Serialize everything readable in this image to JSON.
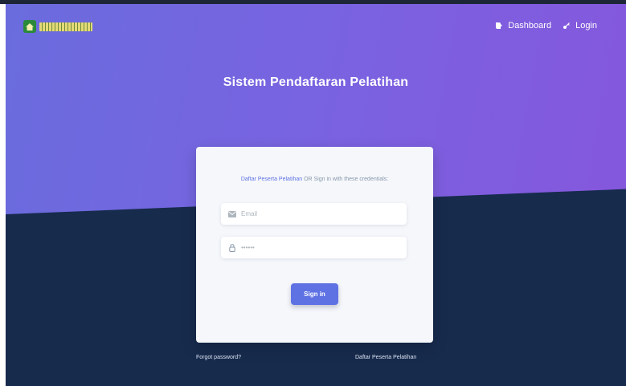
{
  "navbar": {
    "brand_icon": "house-logo-icon",
    "items": [
      {
        "label": "Dashboard",
        "icon": "dashboard-icon"
      },
      {
        "label": "Login",
        "icon": "key-icon"
      }
    ]
  },
  "hero": {
    "title": "Sistem Pendaftaran Pelatihan"
  },
  "login_card": {
    "caption_link": "Daftar Peserta Pelatihan",
    "caption_rest": " OR Sign in with these credentials:",
    "email": {
      "placeholder": "Email",
      "value": "",
      "icon": "email-icon"
    },
    "password": {
      "placeholder": "",
      "value": "••••••",
      "icon": "lock-icon"
    },
    "submit_label": "Sign in"
  },
  "footer_links": {
    "forgot": "Forgot password?",
    "register": "Daftar Peserta Pelatihan"
  },
  "colors": {
    "hero_gradient_start": "#6a6cde",
    "hero_gradient_end": "#8557dc",
    "background_dark": "#172b4d",
    "primary": "#5e72e4"
  }
}
